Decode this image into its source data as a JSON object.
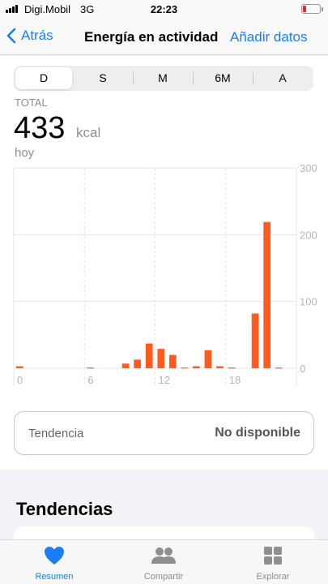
{
  "status_bar": {
    "carrier": "Digi.Mobil",
    "network": "3G",
    "time": "22:23"
  },
  "nav": {
    "back_label": "Atrás",
    "title": "Energía en actividad",
    "action_label": "Añadir datos"
  },
  "segments": {
    "items": [
      "D",
      "S",
      "M",
      "6M",
      "A"
    ],
    "selected": "D"
  },
  "summary": {
    "label": "TOTAL",
    "value": "433",
    "unit": "kcal",
    "period": "hoy"
  },
  "trend": {
    "label": "Tendencia",
    "value": "No disponible"
  },
  "section": {
    "title": "Tendencias"
  },
  "tabs": [
    {
      "label": "Resumen",
      "icon": "heart-icon",
      "active": true
    },
    {
      "label": "Compartir",
      "icon": "people-icon",
      "active": false
    },
    {
      "label": "Explorar",
      "icon": "grid-icon",
      "active": false
    }
  ],
  "colors": {
    "accent": "#1a7df5",
    "bar": "#ff5a1f",
    "grid": "#e4e4e4"
  },
  "chart_data": {
    "type": "bar",
    "x_ticks": [
      "0",
      "6",
      "12",
      "18"
    ],
    "y_ticks": [
      "0",
      "100",
      "200",
      "300"
    ],
    "ylim": [
      0,
      300
    ],
    "x_range": [
      0,
      24
    ],
    "x": [
      0,
      6,
      9,
      10,
      11,
      12,
      13,
      14,
      15,
      16,
      17,
      18,
      20,
      21,
      22
    ],
    "values": [
      3,
      1,
      7,
      13,
      37,
      29,
      20,
      1,
      3,
      27,
      3,
      1,
      82,
      219,
      1
    ]
  }
}
